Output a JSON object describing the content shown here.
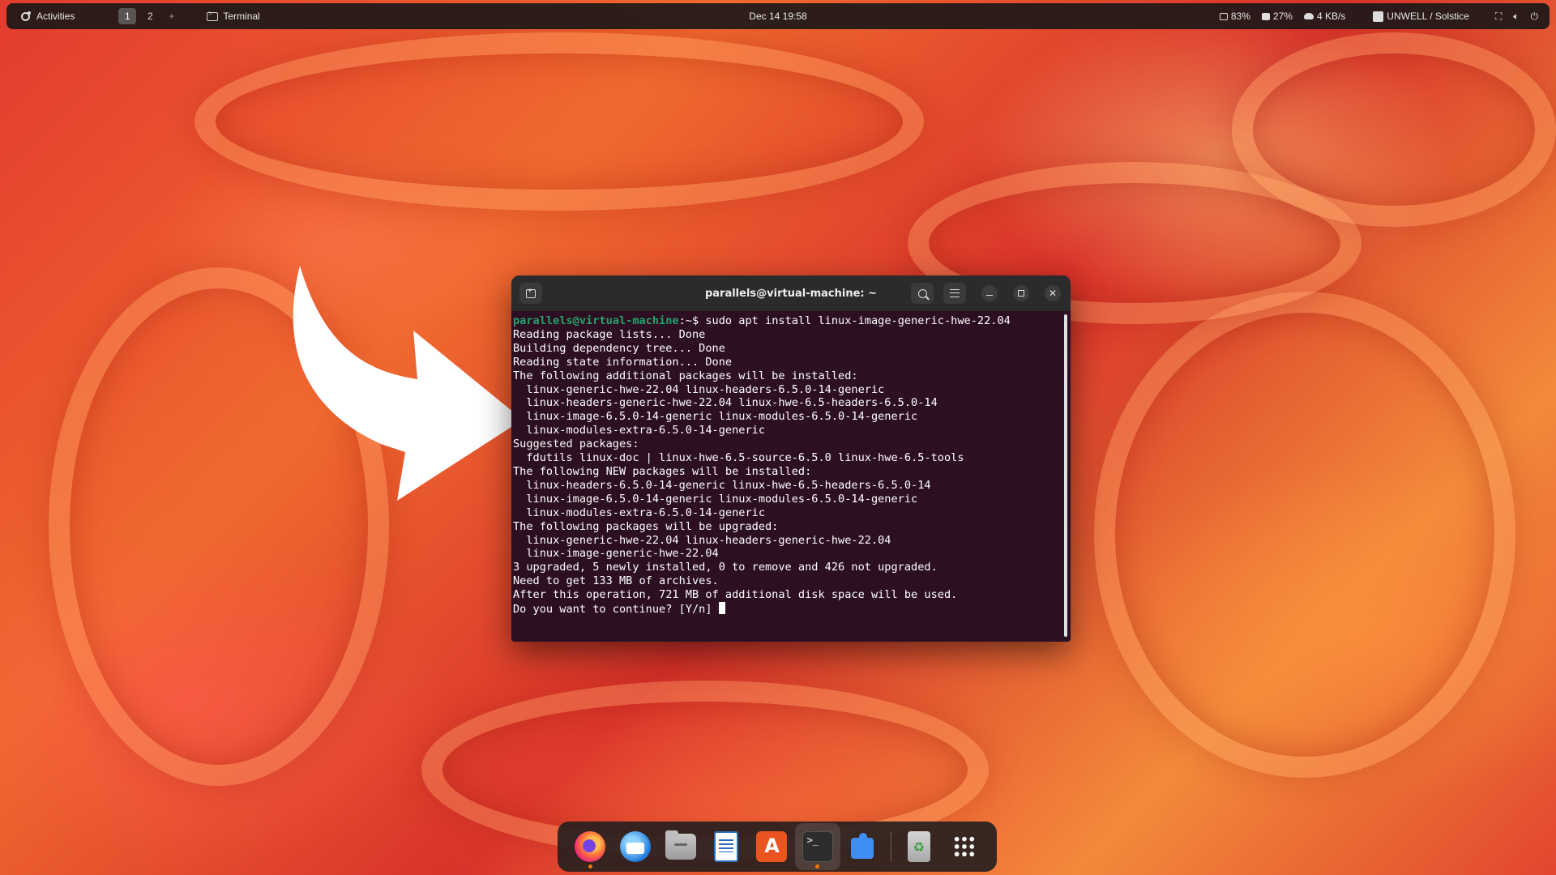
{
  "topbar": {
    "activities_label": "Activities",
    "workspaces": [
      "1",
      "2"
    ],
    "workspace_add": "+",
    "active_app": "Terminal",
    "clock": "Dec 14  19:58",
    "cpu": "83%",
    "memory": "27%",
    "network": "4 KB/s",
    "media": "UNWELL / Solstice"
  },
  "terminal": {
    "title": "parallels@virtual-machine: ~",
    "prompt_user": "parallels@virtual-machine",
    "prompt_path": ":~$ ",
    "command": "sudo apt install linux-image-generic-hwe-22.04",
    "output": [
      "Reading package lists... Done",
      "Building dependency tree... Done",
      "Reading state information... Done",
      "The following additional packages will be installed:",
      "  linux-generic-hwe-22.04 linux-headers-6.5.0-14-generic",
      "  linux-headers-generic-hwe-22.04 linux-hwe-6.5-headers-6.5.0-14",
      "  linux-image-6.5.0-14-generic linux-modules-6.5.0-14-generic",
      "  linux-modules-extra-6.5.0-14-generic",
      "Suggested packages:",
      "  fdutils linux-doc | linux-hwe-6.5-source-6.5.0 linux-hwe-6.5-tools",
      "The following NEW packages will be installed:",
      "  linux-headers-6.5.0-14-generic linux-hwe-6.5-headers-6.5.0-14",
      "  linux-image-6.5.0-14-generic linux-modules-6.5.0-14-generic",
      "  linux-modules-extra-6.5.0-14-generic",
      "The following packages will be upgraded:",
      "  linux-generic-hwe-22.04 linux-headers-generic-hwe-22.04",
      "  linux-image-generic-hwe-22.04",
      "3 upgraded, 5 newly installed, 0 to remove and 426 not upgraded.",
      "Need to get 133 MB of archives.",
      "After this operation, 721 MB of additional disk space will be used."
    ],
    "question": "Do you want to continue? [Y/n] "
  },
  "dock": {
    "apps": [
      "firefox-icon",
      "thunderbird-icon",
      "files-icon",
      "writer-icon",
      "app-center-icon",
      "terminal-icon",
      "extensions-icon",
      "trash-icon",
      "show-apps-icon"
    ]
  },
  "colors": {
    "prompt_green": "#26a269",
    "terminal_bg": "#2c0f22",
    "running_dot": "#f57900"
  }
}
